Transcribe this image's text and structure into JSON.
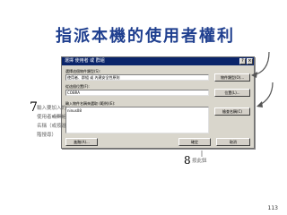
{
  "slide": {
    "title": "指派本機的使用者權利",
    "page_number": "113"
  },
  "dialog": {
    "title": "選擇 使用者 或 群組",
    "object_types_label": "選擇這個物件類型(S):",
    "object_types_value": "使用者、群組 或 內建安全性原則",
    "object_types_button": "物件類型(O)...",
    "location_label": "從這個位置(F):",
    "location_value": "COBRA",
    "location_button": "位置(L)...",
    "names_label": "輸入物件名稱來選取 (範例)(E):",
    "names_value": "ninus08",
    "check_names_button": "檢查名稱(C)",
    "advanced_button": "進階(A)...",
    "ok_button": "確定",
    "cancel_button": "取消"
  },
  "annotations": {
    "step7_number": "7",
    "step7_lines": [
      "輸入要加入的",
      "使用者或群組",
      "名稱（或按進",
      "階搜尋）"
    ],
    "step8_number": "8",
    "step8_text": "按此鈕"
  }
}
